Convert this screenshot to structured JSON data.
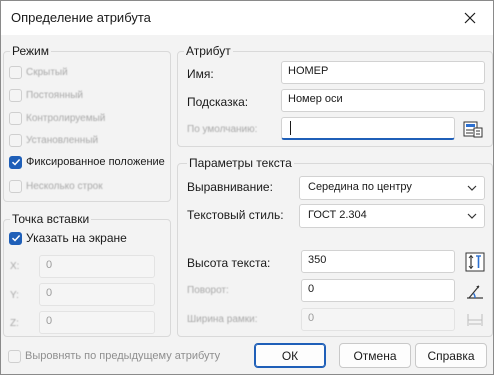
{
  "dialog": {
    "title": "Определение атрибута"
  },
  "mode": {
    "title": "Режим",
    "options": [
      {
        "label": "Скрытый",
        "checked": false,
        "enabled": false
      },
      {
        "label": "Постоянный",
        "checked": false,
        "enabled": false
      },
      {
        "label": "Контролируемый",
        "checked": false,
        "enabled": false
      },
      {
        "label": "Установленный",
        "checked": false,
        "enabled": false
      },
      {
        "label": "Фиксированное положение",
        "checked": true,
        "enabled": true
      },
      {
        "label": "Несколько строк",
        "checked": false,
        "enabled": false
      }
    ]
  },
  "insertion": {
    "title": "Точка вставки",
    "specify_on_screen": "Указать на экране",
    "x_label": "X:",
    "x_value": "0",
    "y_label": "Y:",
    "y_value": "0",
    "z_label": "Z:",
    "z_value": "0"
  },
  "attribute": {
    "title": "Атрибут",
    "name_label": "Имя:",
    "name_value": "НОМЕР",
    "prompt_label": "Подсказка:",
    "prompt_value": "Номер оси",
    "default_label": "По умолчанию:",
    "default_value": ""
  },
  "text_params": {
    "title": "Параметры текста",
    "justify_label": "Выравнивание:",
    "justify_value": "Середина по центру",
    "style_label": "Текстовый стиль:",
    "style_value": "ГОСТ 2.304",
    "height_label": "Высота текста:",
    "height_value": "350",
    "rotation_label": "Поворот:",
    "rotation_value": "0",
    "width_label": "Ширина рамки:",
    "width_value": "0"
  },
  "footer": {
    "align_below": "Выровнять по предыдущему атрибуту",
    "ok": "ОК",
    "cancel": "Отмена",
    "help": "Справка"
  },
  "colors": {
    "accent": "#1f5fb8",
    "background": "#f3f3f3"
  }
}
